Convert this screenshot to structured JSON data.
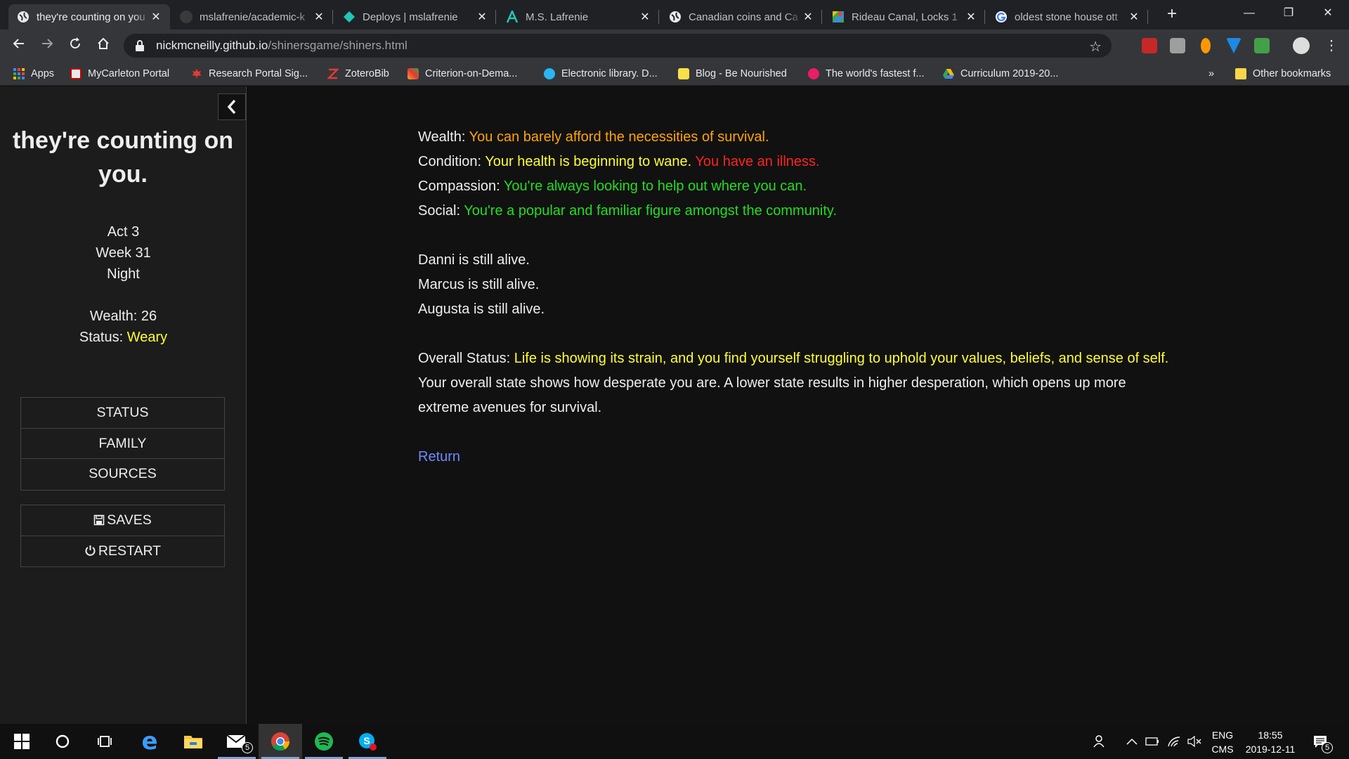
{
  "browser": {
    "tabs": [
      {
        "title": "they're counting on you",
        "favicon": "globe-icon",
        "active": true
      },
      {
        "title": "mslafrenie/academic-k",
        "favicon": "github-icon"
      },
      {
        "title": "Deploys | mslafrenie",
        "favicon": "netlify-icon"
      },
      {
        "title": "M.S. Lafrenie",
        "favicon": "site-logo-icon"
      },
      {
        "title": "Canadian coins and Ca",
        "favicon": "globe-icon"
      },
      {
        "title": "Rideau Canal, Locks 1",
        "favicon": "maps-icon"
      },
      {
        "title": "oldest stone house ott",
        "favicon": "google-icon"
      }
    ],
    "url_host": "nickmcneilly.github.io",
    "url_path": "/shinersgame/shiners.html",
    "bookmarks": [
      {
        "label": "Apps",
        "icon": "apps-grid-icon"
      },
      {
        "label": "MyCarleton Portal",
        "icon": "carleton-icon"
      },
      {
        "label": "Research Portal Sig...",
        "icon": "maple-leaf-icon"
      },
      {
        "label": "ZoteroBib",
        "icon": "zotero-icon"
      },
      {
        "label": "Criterion-on-Dema...",
        "icon": "criterion-icon"
      },
      {
        "label": "Electronic library. D...",
        "icon": "library-icon"
      },
      {
        "label": "Blog - Be Nourished",
        "icon": "blog-icon"
      },
      {
        "label": "The world's fastest f...",
        "icon": "hubspot-icon"
      },
      {
        "label": "Curriculum 2019-20...",
        "icon": "drive-icon"
      }
    ],
    "more_bookmarks": "»",
    "other_bookmarks": "Other bookmarks"
  },
  "sidebar": {
    "collapse": "<",
    "title": "they're counting on you.",
    "act": "Act 3",
    "week": "Week 31",
    "time_of_day": "Night",
    "wealth_label": "Wealth: 26",
    "status_label": "Status: ",
    "status_value": "Weary",
    "menu": [
      "STATUS",
      "FAMILY",
      "SOURCES"
    ],
    "saves": "SAVES",
    "restart": "RESTART"
  },
  "passage": {
    "wealth_label": "Wealth: ",
    "wealth_text": "You can barely afford the necessities of survival.",
    "condition_label": "Condition: ",
    "condition_text": "Your health is beginning to wane.",
    "condition_illness": "You have an illness.",
    "compassion_label": "Compassion: ",
    "compassion_text": "You're always looking to help out where you can.",
    "social_label": "Social: ",
    "social_text": "You're a popular and familiar figure amongst the community.",
    "family": [
      "Danni is still alive.",
      "Marcus is still alive.",
      "Augusta is still alive."
    ],
    "overall_label": "Overall Status: ",
    "overall_text": "Life is showing its strain, and you find yourself struggling to uphold your values, beliefs, and sense of self.",
    "explanation": "Your overall state shows how desperate you are. A lower state results in higher desperation, which opens up more extreme avenues for survival.",
    "return_link": "Return"
  },
  "colors": {
    "orange": "#ffa500",
    "yellow": "#ffff33",
    "red": "#ff2222",
    "green": "#22dd22",
    "link": "#6b8cff"
  },
  "taskbar": {
    "mail_badge": "5",
    "lang_top": "ENG",
    "lang_bottom": "CMS",
    "time": "18:55",
    "date": "2019-12-11",
    "notification_count": "5"
  }
}
